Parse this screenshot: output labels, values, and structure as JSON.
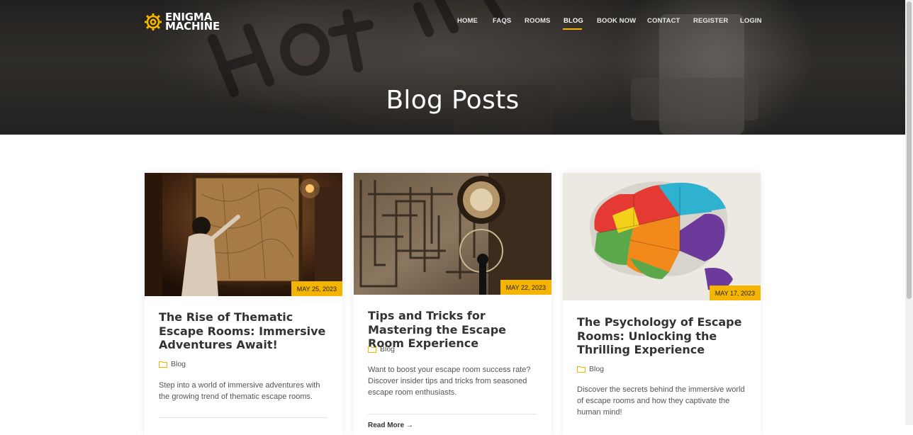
{
  "header": {
    "logo": {
      "line1": "ENIGMA",
      "line2": "MACHINE",
      "icon": "gear-icon",
      "accent": "#f5b400"
    },
    "nav": [
      {
        "label": "HOME"
      },
      {
        "label": "FAQS"
      },
      {
        "label": "ROOMS"
      },
      {
        "label": "BLOG",
        "active": true
      },
      {
        "label": "BOOK NOW"
      },
      {
        "label": "CONTACT"
      },
      {
        "label": "REGISTER"
      },
      {
        "label": "LOGIN"
      }
    ]
  },
  "hero": {
    "title": "Blog Posts"
  },
  "posts": [
    {
      "date": "MAY 25, 2023",
      "title": "The Rise of Thematic Escape Rooms: Immersive Adventures Await!",
      "category": "Blog",
      "category_icon": "folder-icon",
      "excerpt": "Step into a world of immersive adventures with the growing trend of thematic escape rooms."
    },
    {
      "date": "MAY 22, 2023",
      "title": "Tips and Tricks for Mastering the Escape Room Experience",
      "category": "Blog",
      "category_icon": "folder-icon",
      "excerpt": "Want to boost your escape room success rate? Discover insider tips and tricks from seasoned escape room enthusiasts.",
      "read_more": "Read More →"
    },
    {
      "date": "MAY 17, 2023",
      "title": "The Psychology of Escape Rooms: Unlocking the Thrilling Experience",
      "category": "Blog",
      "category_icon": "folder-icon",
      "excerpt": "Discover the secrets behind the immersive world of escape rooms and how they captivate the human mind!"
    }
  ],
  "colors": {
    "accent": "#f5b400",
    "text_dark": "#333333",
    "text_body": "#555555"
  }
}
